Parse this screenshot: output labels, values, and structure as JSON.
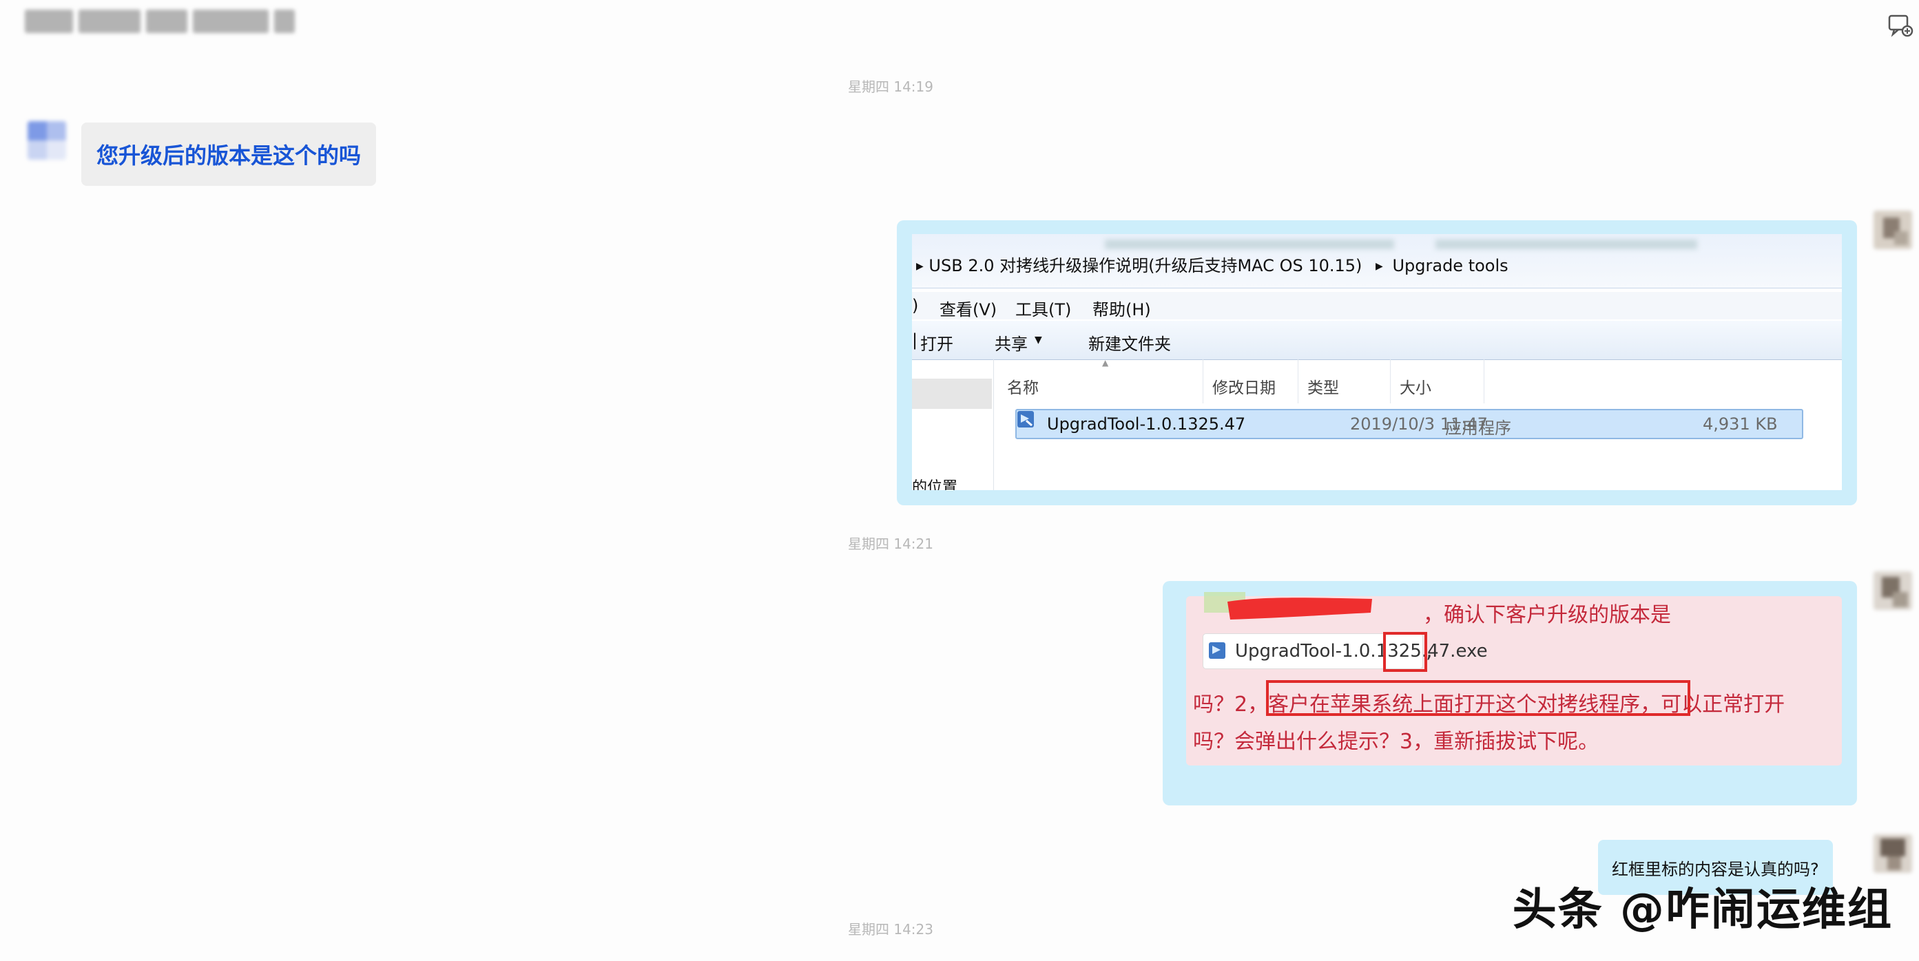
{
  "header": {
    "title_obscured": true
  },
  "timestamps": [
    "星期四  14:19",
    "星期四  14:21",
    "星期四  14:23"
  ],
  "messages": {
    "left_question": "您升级后的版本是这个的吗",
    "right_question": "红框里标的内容是认真的吗?"
  },
  "screenshot1": {
    "path": "USB 2.0 对拷线升级操作说明(升级后支持MAC OS 10.15)",
    "path_last": "Upgrade tools",
    "menu": [
      "查看(V)",
      "工具(T)",
      "帮助(H)"
    ],
    "toolbar": [
      "打开",
      "共享",
      "新建文件夹"
    ],
    "columns": [
      "名称",
      "修改日期",
      "类型",
      "大小"
    ],
    "file": {
      "name": "UpgradTool-1.0.1325.47",
      "date": "2019/10/3 11:47",
      "type": "应用程序",
      "size": "4,931 KB"
    },
    "nav_location": "的位置"
  },
  "screenshot2": {
    "line1": "，确认下客户升级的版本是",
    "attachment": "UpgradTool-1.0.1325.47.exe",
    "line2_prefix": "吗？2，",
    "line2_highlight": "客户在苹果系统上面打开这个对拷线程序，",
    "line2_suffix": "可以正常打开",
    "line3": "吗？会弹出什么提示？3，重新插拔试下呢。"
  },
  "watermark": "头条 @咋闹运维组",
  "colors": {
    "bubble_left": "#eeeeee",
    "bubble_right": "#cdeefb",
    "left_text": "#1855d6",
    "pink_text": "#c4293b",
    "highlight": "#e02a2a"
  }
}
